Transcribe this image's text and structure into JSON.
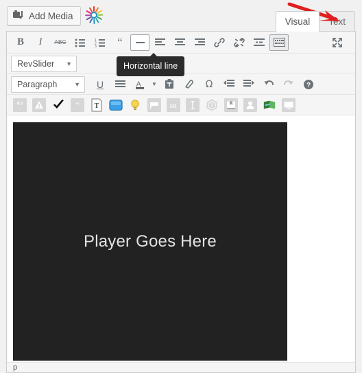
{
  "window": {
    "background": "#f1f1f1"
  },
  "media_bar": {
    "add_media_label": "Add Media",
    "add_media_icon": "add-media-icon",
    "plugin_icon": "starburst-plugin-icon",
    "tabs": [
      {
        "label": "Visual",
        "active": true
      },
      {
        "label": "Text",
        "active": false
      }
    ],
    "annotation": {
      "type": "red-arrow",
      "color": "#e02020",
      "points_to": "Text"
    }
  },
  "toolbar_row_1": {
    "buttons": [
      {
        "name": "bold-button",
        "glyph": "B",
        "state": "normal"
      },
      {
        "name": "italic-button",
        "glyph": "I",
        "state": "normal"
      },
      {
        "name": "strikethrough-button",
        "glyph": "ABC",
        "state": "normal"
      },
      {
        "name": "bulleted-list-button",
        "glyph": "ul",
        "state": "normal"
      },
      {
        "name": "numbered-list-button",
        "glyph": "ol",
        "state": "normal"
      },
      {
        "name": "blockquote-button",
        "glyph": "“",
        "state": "normal"
      },
      {
        "name": "horizontal-line-button",
        "glyph": "hr",
        "state": "active"
      },
      {
        "name": "align-left-button",
        "glyph": "align-left",
        "state": "normal"
      },
      {
        "name": "align-center-button",
        "glyph": "align-center",
        "state": "normal"
      },
      {
        "name": "align-right-button",
        "glyph": "align-right",
        "state": "normal"
      },
      {
        "name": "insert-link-button",
        "glyph": "link",
        "state": "normal"
      },
      {
        "name": "unlink-button",
        "glyph": "unlink",
        "state": "normal"
      },
      {
        "name": "insert-read-more-button",
        "glyph": "more",
        "state": "normal"
      },
      {
        "name": "toolbar-toggle-button",
        "glyph": "kitchen-sink",
        "state": "toggled"
      },
      {
        "name": "fullscreen-button",
        "glyph": "fullscreen",
        "state": "normal"
      }
    ]
  },
  "toolbar_row_2": {
    "revslider_select": {
      "label": "RevSlider",
      "caret": "▼"
    },
    "tooltip": {
      "text": "Horizontal line"
    }
  },
  "toolbar_row_3": {
    "paragraph_select": {
      "label": "Paragraph",
      "caret": "▼"
    },
    "buttons": [
      {
        "name": "underline-button",
        "glyph": "U",
        "state": "normal"
      },
      {
        "name": "align-justify-button",
        "glyph": "justify",
        "state": "normal"
      },
      {
        "name": "text-color-button",
        "glyph": "A",
        "state": "normal"
      },
      {
        "name": "text-color-dropdown",
        "glyph": "▼",
        "state": "normal"
      },
      {
        "name": "paste-as-text-button",
        "glyph": "clipboard-t",
        "state": "normal"
      },
      {
        "name": "clear-formatting-button",
        "glyph": "eraser",
        "state": "normal"
      },
      {
        "name": "special-character-button",
        "glyph": "Ω",
        "state": "normal"
      },
      {
        "name": "decrease-indent-button",
        "glyph": "outdent",
        "state": "normal"
      },
      {
        "name": "increase-indent-button",
        "glyph": "indent",
        "state": "normal"
      },
      {
        "name": "undo-button",
        "glyph": "undo",
        "state": "normal"
      },
      {
        "name": "redo-button",
        "glyph": "redo",
        "state": "disabled"
      },
      {
        "name": "keyboard-shortcuts-button",
        "glyph": "?",
        "state": "normal"
      }
    ]
  },
  "toolbar_row_4": {
    "buttons": [
      {
        "name": "version-badge-icon",
        "label": "9.0"
      },
      {
        "name": "warning-triangle-icon",
        "label": ""
      },
      {
        "name": "checkmark-icon",
        "label": ""
      },
      {
        "name": "quote-icon",
        "label": "“"
      },
      {
        "name": "text-document-icon",
        "label": "T"
      },
      {
        "name": "blue-box-icon",
        "label": ""
      },
      {
        "name": "lightbulb-icon",
        "label": ""
      },
      {
        "name": "flag-icon",
        "label": ""
      },
      {
        "name": "heading-icon",
        "label": "H1"
      },
      {
        "name": "text-cursor-icon",
        "label": "I"
      },
      {
        "name": "info-hexagon-icon",
        "label": "i"
      },
      {
        "name": "bookmark-box-icon",
        "label": ""
      },
      {
        "name": "user-icon",
        "label": ""
      },
      {
        "name": "green-book-icon",
        "label": ""
      },
      {
        "name": "monitor-icon",
        "label": ""
      }
    ]
  },
  "content": {
    "player_placeholder_text": "Player Goes Here",
    "player_background": "#222222"
  },
  "status_bar": {
    "path": "p"
  }
}
